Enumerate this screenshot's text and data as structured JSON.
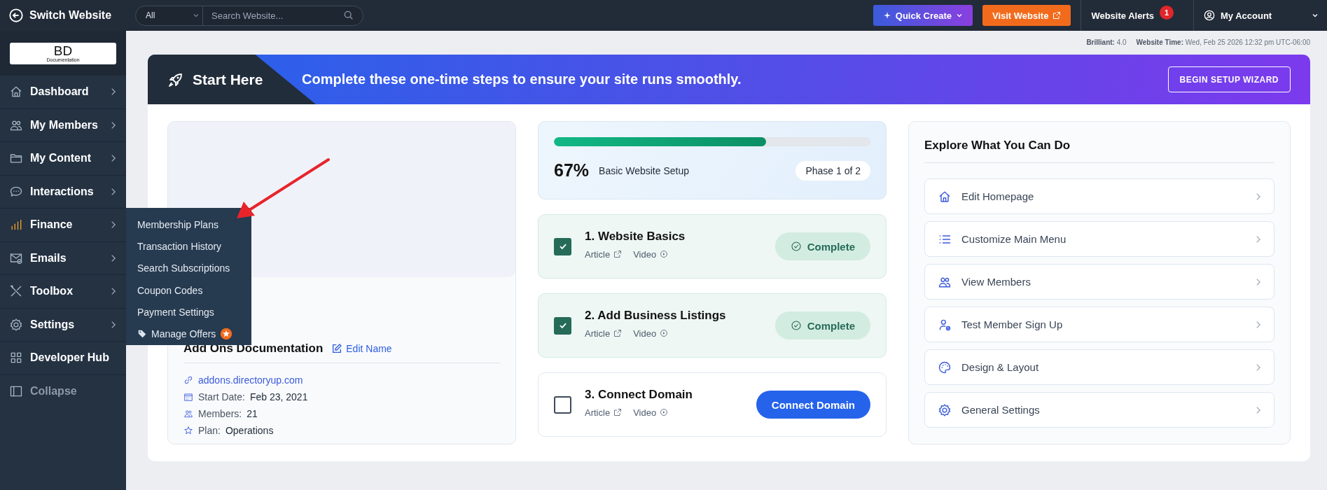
{
  "topbar": {
    "switch_label": "Switch Website",
    "search": {
      "scope": "All",
      "placeholder": "Search Website..."
    },
    "quick_create": "Quick Create",
    "visit": "Visit Website",
    "alerts": {
      "label": "Website Alerts",
      "count": "1"
    },
    "account": "My Account"
  },
  "logo": {
    "mark": "BD",
    "caption": "Documentation"
  },
  "sidebar": {
    "items": [
      {
        "label": "Dashboard",
        "kind": "menu",
        "selected": false
      },
      {
        "label": "My Members",
        "kind": "menu",
        "selected": false
      },
      {
        "label": "My Content",
        "kind": "menu",
        "selected": false
      },
      {
        "label": "Interactions",
        "kind": "menu",
        "selected": false
      },
      {
        "label": "Finance",
        "kind": "menu",
        "selected": true
      },
      {
        "label": "Emails",
        "kind": "menu",
        "selected": false
      },
      {
        "label": "Toolbox",
        "kind": "menu",
        "selected": false
      },
      {
        "label": "Settings",
        "kind": "menu",
        "selected": false
      },
      {
        "label": "Developer Hub",
        "kind": "link",
        "selected": false
      },
      {
        "label": "Collapse",
        "kind": "collapse",
        "selected": false
      }
    ]
  },
  "flyout": {
    "items": [
      {
        "label": "Membership Plans",
        "kind": "plain"
      },
      {
        "label": "Transaction History",
        "kind": "plain"
      },
      {
        "label": "Search Subscriptions",
        "kind": "plain"
      },
      {
        "label": "Coupon Codes",
        "kind": "plain"
      },
      {
        "label": "Payment Settings",
        "kind": "plain"
      },
      {
        "label": "Manage Offers",
        "kind": "offer"
      }
    ]
  },
  "meta": {
    "version_label": "Brilliant:",
    "version": "4.0",
    "time_label": "Website Time:",
    "time": "Wed, Feb 25 2026 12:32 pm UTC-06:00"
  },
  "banner": {
    "title": "Start Here",
    "message": "Complete these one-time steps to ensure your site runs smoothly.",
    "button": "BEGIN SETUP WIZARD"
  },
  "site_card": {
    "name": "Add Ons Documentation",
    "edit": "Edit Name",
    "url": "addons.directoryup.com",
    "details": [
      {
        "label": "Start Date:",
        "value": "Feb 23, 2021"
      },
      {
        "label": "Members:",
        "value": "21"
      },
      {
        "label": "Plan:",
        "value": "Operations"
      }
    ]
  },
  "progress": {
    "level": 0.67,
    "percent": "67%",
    "label": "Basic Website Setup",
    "phase": "Phase 1 of 2"
  },
  "steps": [
    {
      "title": "1. Website Basics",
      "checked": true,
      "article": "Article",
      "video": "Video",
      "status": "Complete"
    },
    {
      "title": "2. Add Business Listings",
      "checked": true,
      "article": "Article",
      "video": "Video",
      "status": "Complete"
    },
    {
      "title": "3. Connect Domain",
      "checked": false,
      "article": "Article",
      "video": "Video",
      "action": "Connect Domain"
    }
  ],
  "explore": {
    "title": "Explore What You Can Do",
    "items": [
      {
        "label": "Edit Homepage"
      },
      {
        "label": "Customize Main Menu"
      },
      {
        "label": "View Members"
      },
      {
        "label": "Test Member Sign Up"
      },
      {
        "label": "Design & Layout"
      },
      {
        "label": "General Settings"
      }
    ]
  }
}
